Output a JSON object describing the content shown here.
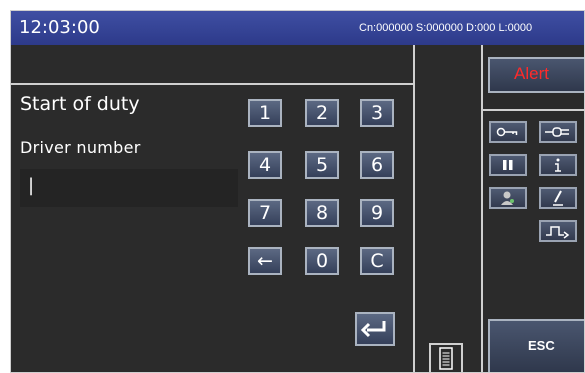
{
  "status_bar": {
    "time": "12:03:00",
    "counters": "Cn:000000  S:000000  D:000  L:0000"
  },
  "form": {
    "title": "Start of duty",
    "field_label": "Driver number",
    "field_value": "|"
  },
  "keypad": {
    "keys": [
      "1",
      "2",
      "3",
      "4",
      "5",
      "6",
      "7",
      "8",
      "9",
      "←",
      "0",
      "C"
    ],
    "enter_icon": "enter-return-icon"
  },
  "side_panel": {
    "alert_label": "Alert",
    "esc_label": "ESC",
    "buttons": [
      "key-icon",
      "plug-icon",
      "pause-icon",
      "info-icon",
      "contact-icon",
      "pen-icon",
      "route-icon"
    ]
  },
  "colors": {
    "title_bar": "#2d3a8a",
    "background": "#2b2b2b",
    "alert_text": "#ff2a2a"
  }
}
